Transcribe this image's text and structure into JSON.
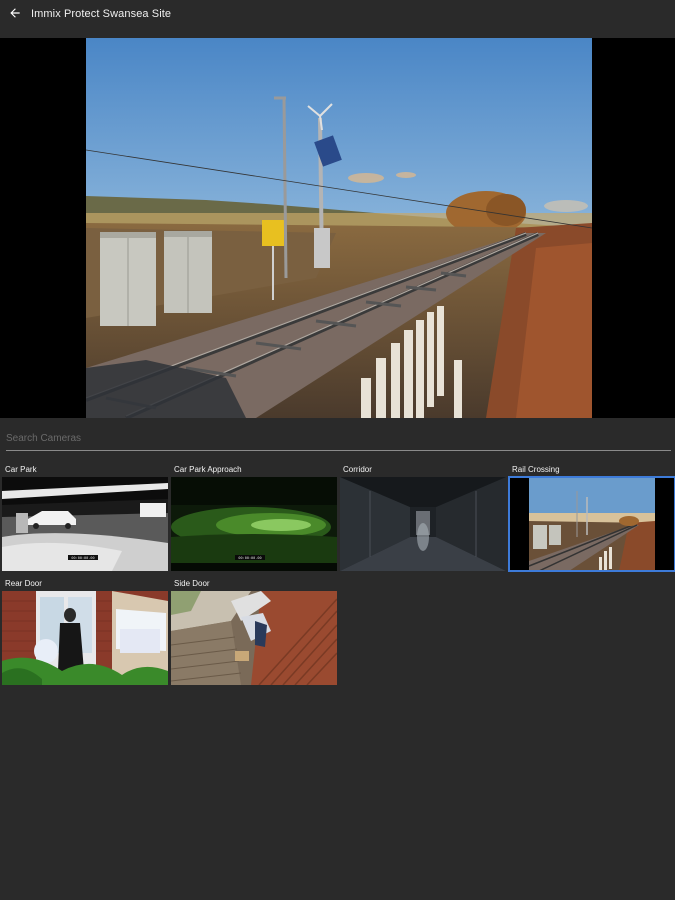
{
  "header": {
    "title": "Immix Protect Swansea Site",
    "back_icon": "arrow-left-icon"
  },
  "viewer": {
    "selected_camera": "Rail Crossing"
  },
  "search": {
    "placeholder": "Search Cameras",
    "value": ""
  },
  "cameras": [
    {
      "label": "Car Park",
      "timestamp": "00:00:00.00"
    },
    {
      "label": "Car Park Approach",
      "timestamp": "00:00:00.00"
    },
    {
      "label": "Corridor"
    },
    {
      "label": "Rail Crossing",
      "selected": true
    },
    {
      "label": "Rear Door"
    },
    {
      "label": "Side Door"
    }
  ],
  "colors": {
    "background": "#2a2a2a",
    "selection": "#3d7bd9"
  }
}
